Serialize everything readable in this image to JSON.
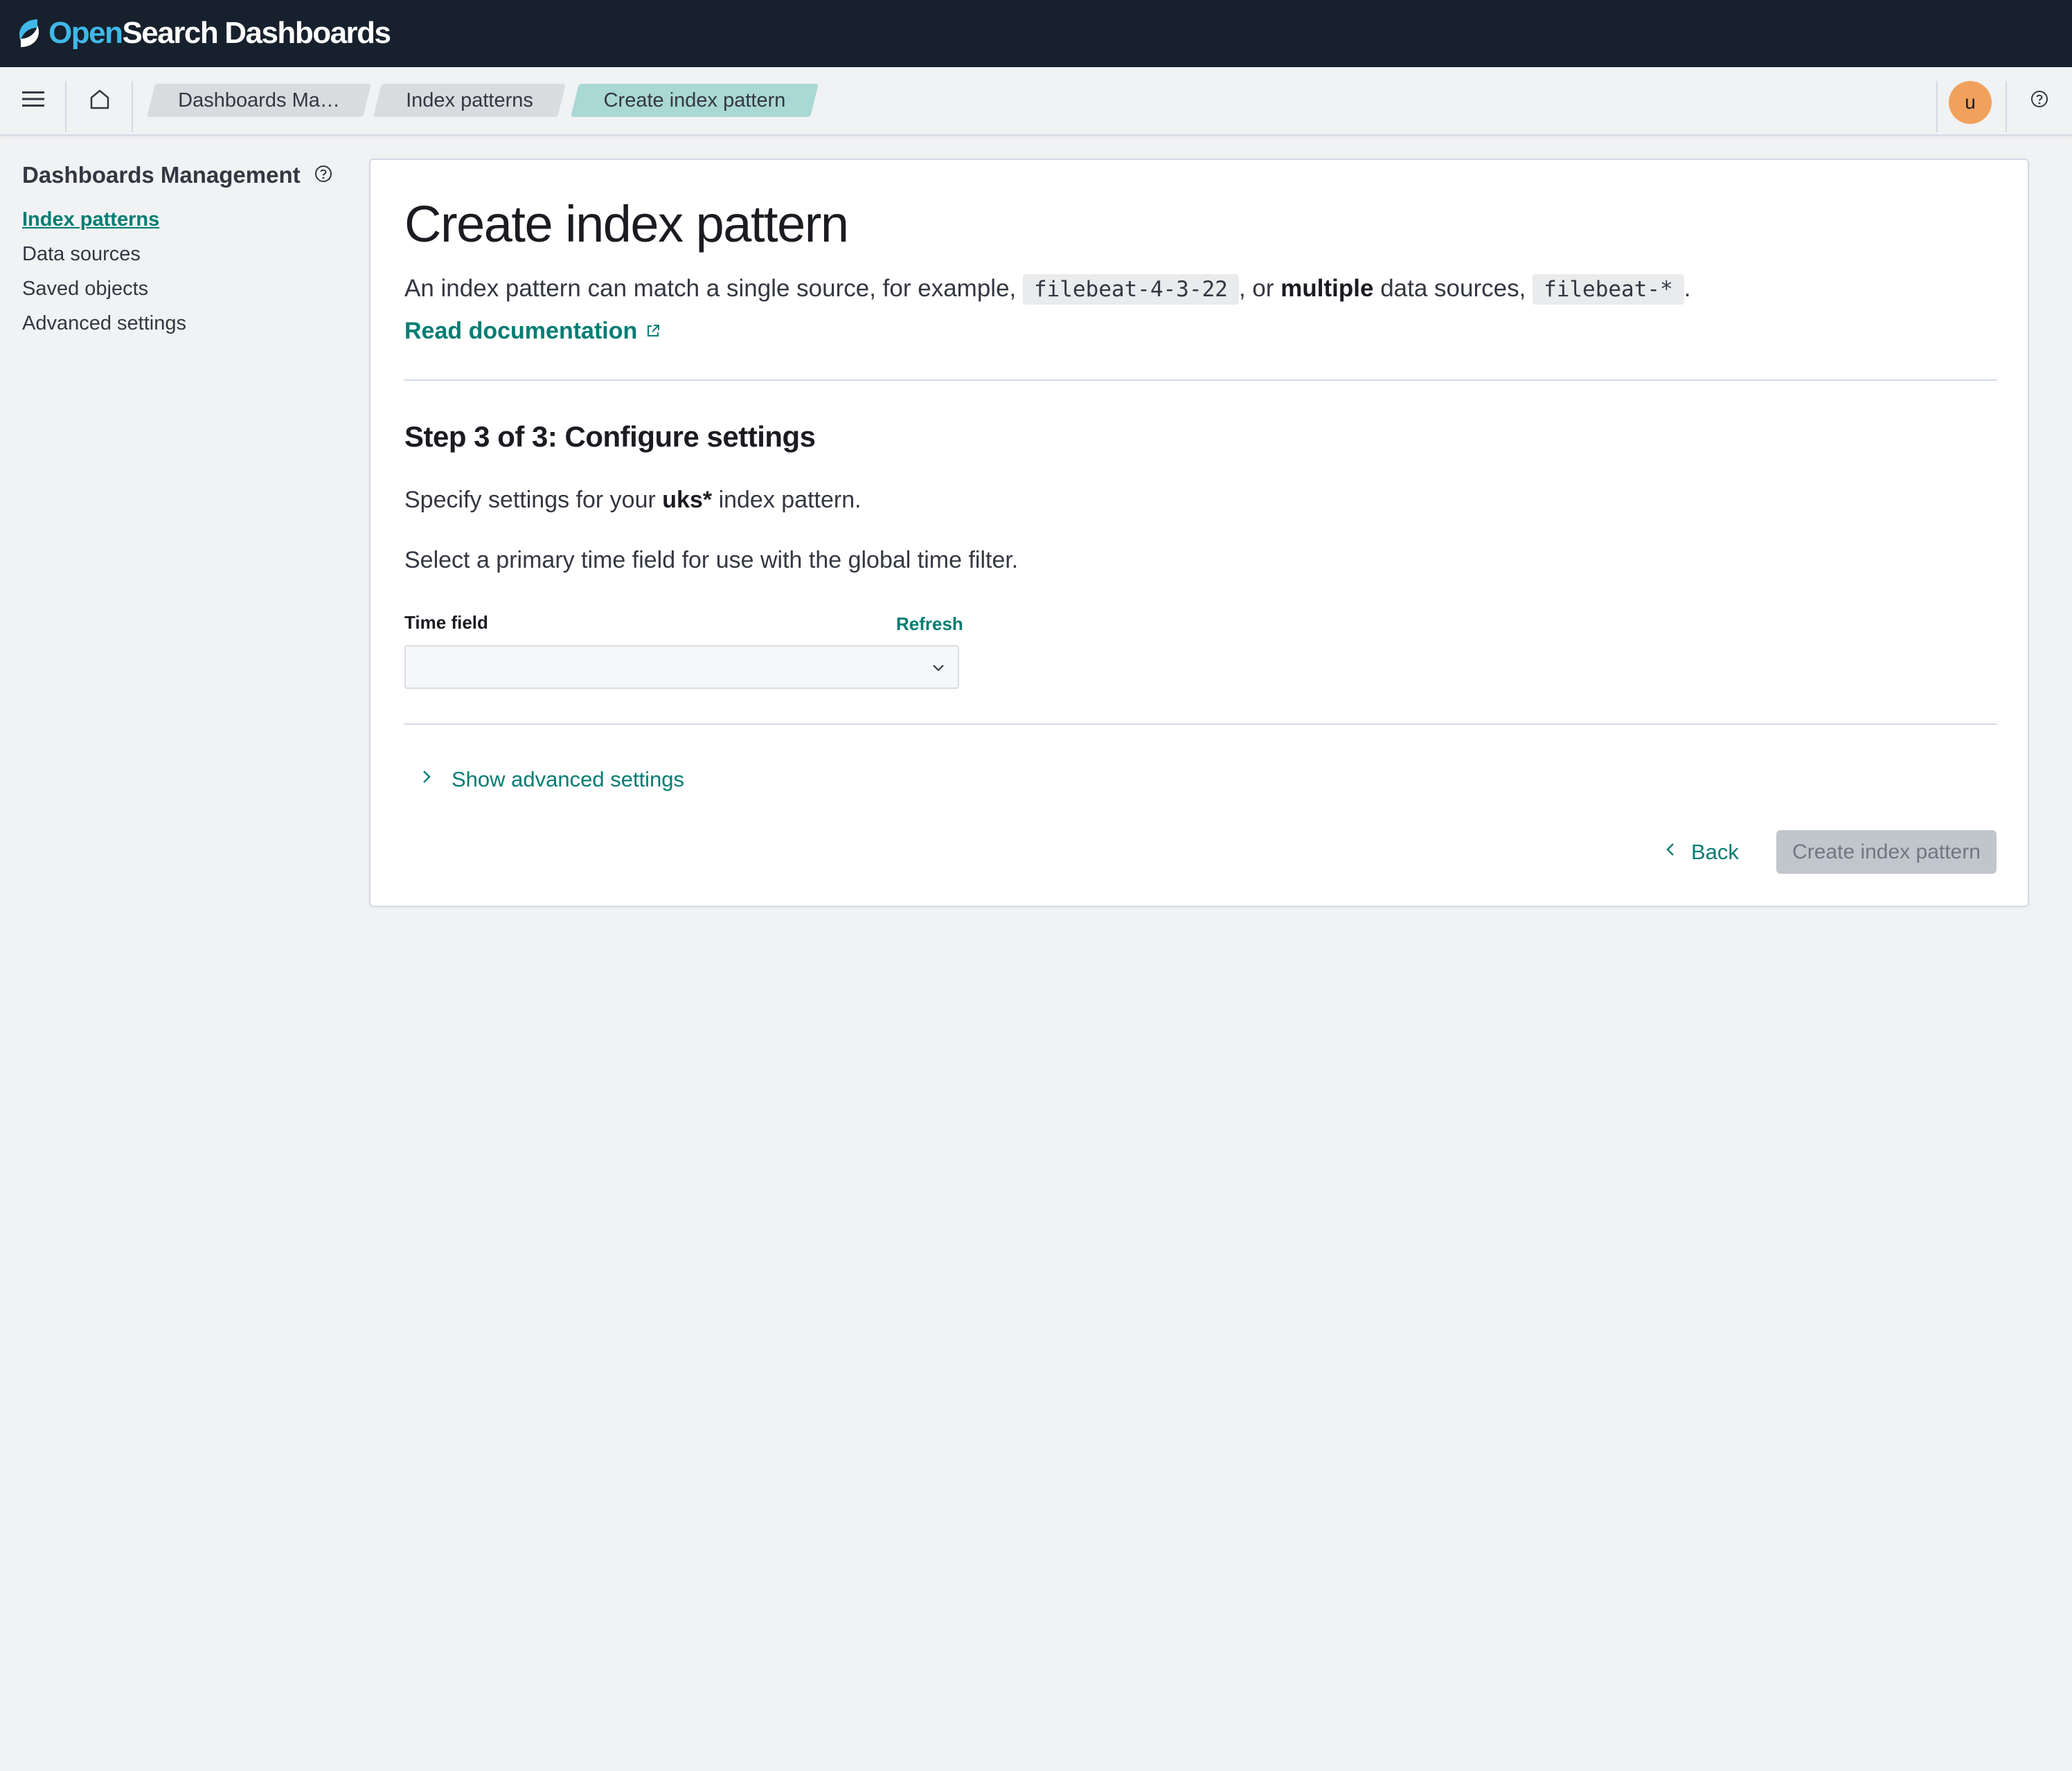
{
  "header": {
    "logo_open": "Open",
    "logo_search": "Search",
    "logo_dashboards": "Dashboards"
  },
  "breadcrumbs": [
    {
      "label": "Dashboards Ma…"
    },
    {
      "label": "Index patterns"
    },
    {
      "label": "Create index pattern"
    }
  ],
  "user": {
    "avatar_initial": "u"
  },
  "sidebar": {
    "title": "Dashboards Management",
    "items": [
      {
        "label": "Index patterns",
        "active": true
      },
      {
        "label": "Data sources"
      },
      {
        "label": "Saved objects"
      },
      {
        "label": "Advanced settings"
      }
    ]
  },
  "main": {
    "title": "Create index pattern",
    "desc_part1": "An index pattern can match a single source, for example,",
    "desc_code1": "filebeat-4-3-22",
    "desc_part2": ", or",
    "desc_bold": "multiple",
    "desc_part3": "data sources,",
    "desc_code2": "filebeat-*",
    "desc_end": ".",
    "doc_link": "Read documentation",
    "step_title": "Step 3 of 3: Configure settings",
    "specify_prefix": "Specify settings for your",
    "specify_pattern": "uks*",
    "specify_suffix": "index pattern.",
    "select_hint": "Select a primary time field for use with the global time filter.",
    "time_field_label": "Time field",
    "refresh_label": "Refresh",
    "time_field_value": "",
    "advanced_label": "Show advanced settings",
    "back_label": "Back",
    "create_label": "Create index pattern"
  },
  "colors": {
    "header_bg": "#17202d",
    "accent": "#017d73",
    "avatar": "#f0a15c",
    "disabled_button": "#c1c6cc"
  },
  "icons": [
    "opensearch-logo-icon",
    "menu-icon",
    "home-icon",
    "help-icon",
    "external-link-icon",
    "chevron-down-icon",
    "chevron-right-icon",
    "chevron-left-icon"
  ]
}
